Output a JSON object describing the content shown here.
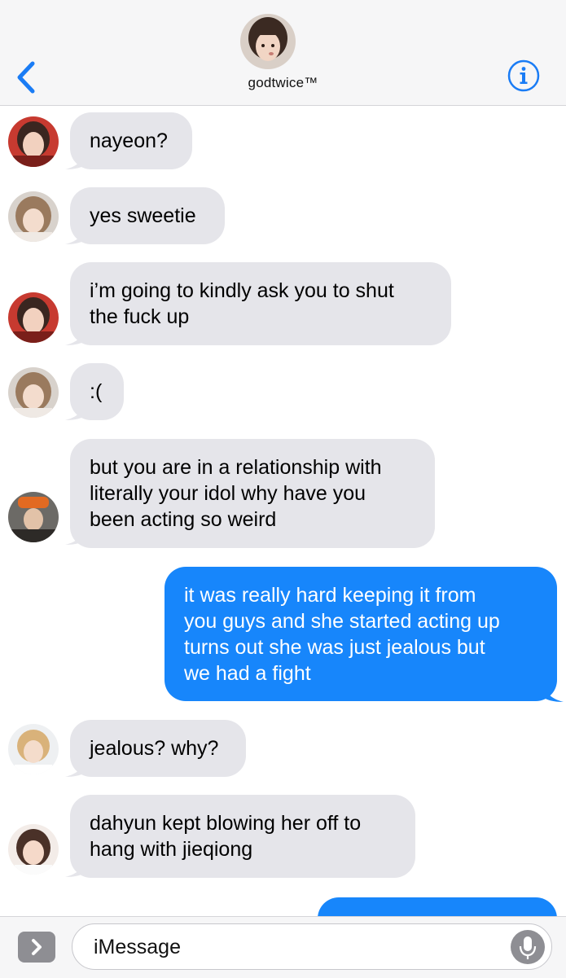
{
  "header": {
    "title": "godtwice™",
    "back_icon": "chevron-left-icon",
    "info_icon": "info-icon",
    "accent": "#1a7cf5"
  },
  "messages": [
    {
      "side": "in",
      "avatar": "member-avatar-a",
      "text": "nayeon?"
    },
    {
      "side": "in",
      "avatar": "member-avatar-b",
      "text": "yes sweetie"
    },
    {
      "side": "in",
      "avatar": "member-avatar-a",
      "lines": [
        "i’m going to kindly ask you to shut",
        "the fuck up"
      ]
    },
    {
      "side": "in",
      "avatar": "member-avatar-b",
      "text": ":("
    },
    {
      "side": "in",
      "avatar": "member-avatar-c",
      "lines": [
        "but you are in a relationship with",
        "literally your idol why have you",
        "been acting so weird"
      ]
    },
    {
      "side": "out",
      "lines": [
        "it was really hard keeping it from",
        "you guys and she started acting up",
        "turns out she was just jealous but",
        "we had a fight"
      ]
    },
    {
      "side": "in",
      "avatar": "member-avatar-d",
      "text": "jealous? why?"
    },
    {
      "side": "in",
      "avatar": "member-avatar-e",
      "lines": [
        "dahyun kept blowing her off to",
        "hang with jieqiong"
      ]
    }
  ],
  "colors": {
    "incoming_bubble": "#e5e5ea",
    "outgoing_bubble": "#1786fb"
  },
  "input": {
    "placeholder": "iMessage",
    "apps_icon": "chevron-right-icon",
    "mic_icon": "microphone-icon"
  }
}
